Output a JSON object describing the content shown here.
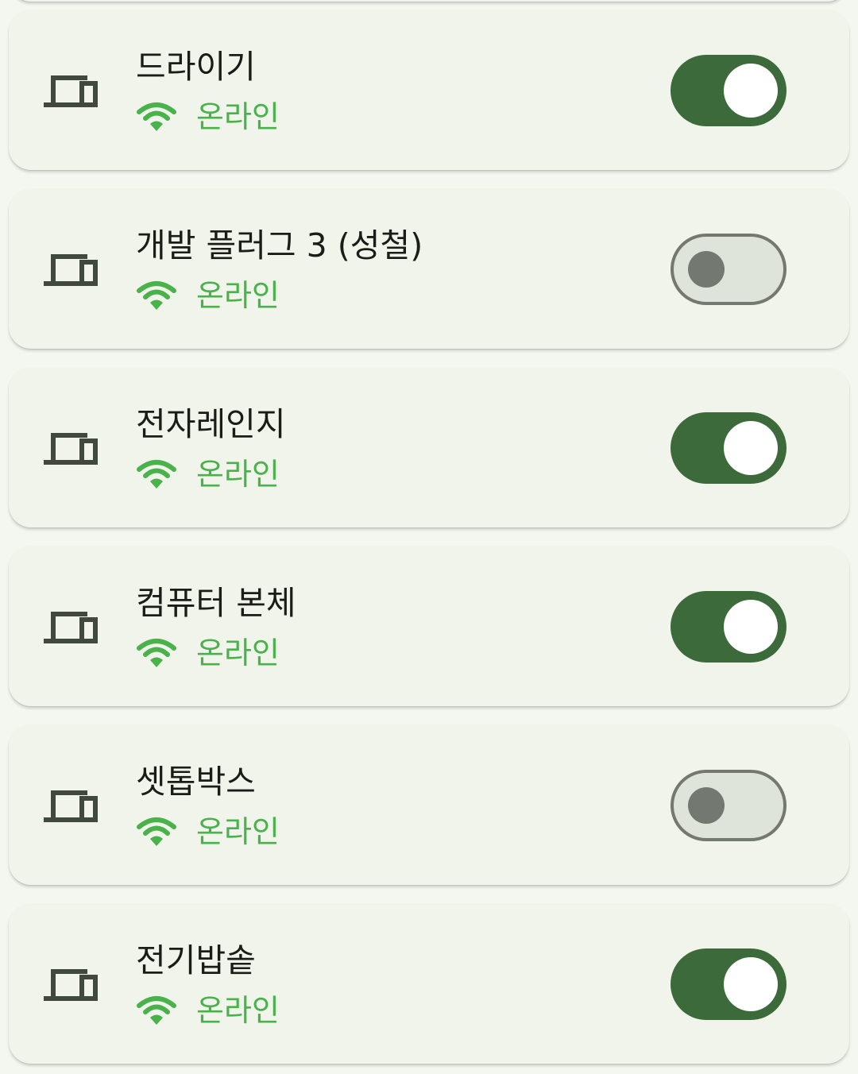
{
  "colors": {
    "background": "#f4f7ef",
    "card": "#f0f4ea",
    "title_text": "#1b1c18",
    "status_green": "#49b24b",
    "toggle_on_track": "#3c6a3a",
    "toggle_on_knob": "#ffffff",
    "toggle_off_track": "#dfe4da",
    "toggle_off_outline": "#737970",
    "icon": "#41493f"
  },
  "devices": [
    {
      "name": "드라이기",
      "status": "온라인",
      "status_icon": "wifi-icon",
      "device_icon": "devices-icon",
      "enabled": true
    },
    {
      "name": "개발 플러그 3 (성철)",
      "status": "온라인",
      "status_icon": "wifi-icon",
      "device_icon": "devices-icon",
      "enabled": false
    },
    {
      "name": "전자레인지",
      "status": "온라인",
      "status_icon": "wifi-icon",
      "device_icon": "devices-icon",
      "enabled": true
    },
    {
      "name": "컴퓨터 본체",
      "status": "온라인",
      "status_icon": "wifi-icon",
      "device_icon": "devices-icon",
      "enabled": true
    },
    {
      "name": "셋톱박스",
      "status": "온라인",
      "status_icon": "wifi-icon",
      "device_icon": "devices-icon",
      "enabled": false
    },
    {
      "name": "전기밥솥",
      "status": "온라인",
      "status_icon": "wifi-icon",
      "device_icon": "devices-icon",
      "enabled": true
    }
  ]
}
